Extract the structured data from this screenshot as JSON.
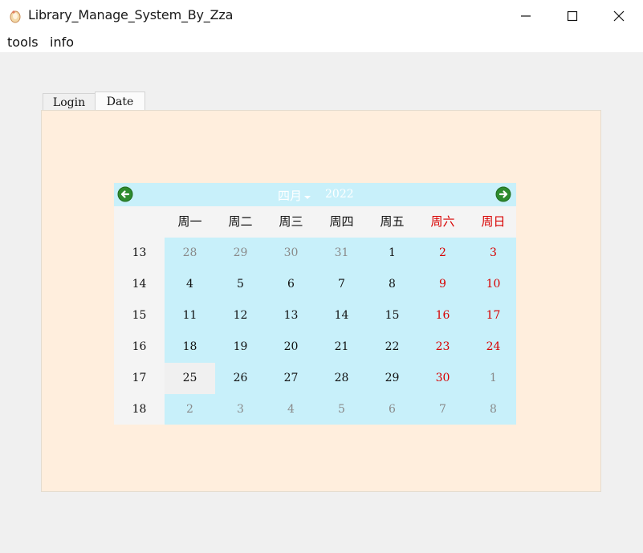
{
  "window": {
    "title": "Library_Manage_System_By_Zza",
    "controls": [
      "minimize",
      "maximize",
      "close"
    ]
  },
  "menu": {
    "items": [
      "tools",
      "info"
    ]
  },
  "tabs": [
    {
      "label": "Login",
      "active": false
    },
    {
      "label": "Date",
      "active": true
    }
  ],
  "calendar": {
    "month": "四月",
    "year": "2022",
    "weekday_headers": [
      "周一",
      "周二",
      "周三",
      "周四",
      "周五",
      "周六",
      "周日"
    ],
    "week_numbers": [
      "13",
      "14",
      "15",
      "16",
      "17",
      "18"
    ],
    "weeks": [
      [
        "28",
        "29",
        "30",
        "31",
        "1",
        "2",
        "3"
      ],
      [
        "4",
        "5",
        "6",
        "7",
        "8",
        "9",
        "10"
      ],
      [
        "11",
        "12",
        "13",
        "14",
        "15",
        "16",
        "17"
      ],
      [
        "18",
        "19",
        "20",
        "21",
        "22",
        "23",
        "24"
      ],
      [
        "25",
        "26",
        "27",
        "28",
        "29",
        "30",
        "1"
      ],
      [
        "2",
        "3",
        "4",
        "5",
        "6",
        "7",
        "8"
      ]
    ],
    "selected_date": "25",
    "colors": {
      "background": "#c8f0fa",
      "weekend": "#d80000",
      "other_month": "#8a8a8a",
      "nav_arrow": "#2e8b2e",
      "panel": "#ffeedd"
    }
  }
}
